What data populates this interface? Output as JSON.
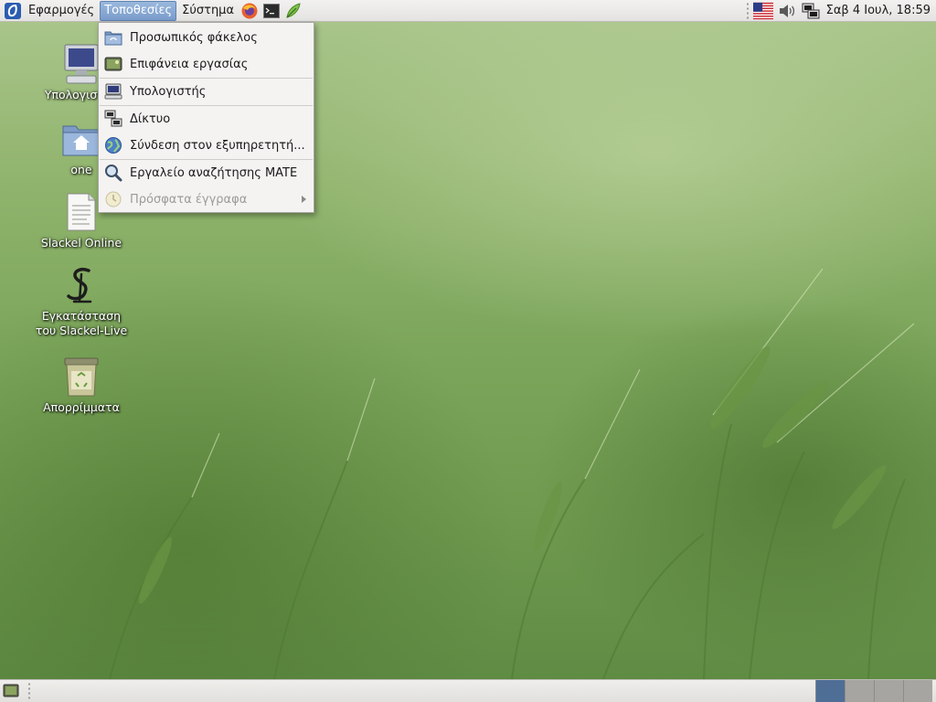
{
  "top_panel": {
    "menus": [
      {
        "label": "Εφαρμογές",
        "active": false
      },
      {
        "label": "Τοποθεσίες",
        "active": true
      },
      {
        "label": "Σύστημα",
        "active": false
      }
    ],
    "launchers": [
      "firefox-icon",
      "terminal-icon",
      "text-editor-icon"
    ],
    "tray": [
      "us-flag-keyboard-layout-icon",
      "volume-icon",
      "network-icon"
    ],
    "clock": "Σαβ  4 Ιουλ, 18:59"
  },
  "places_menu": {
    "items": [
      {
        "label": "Προσωπικός φάκελος",
        "icon": "home-folder-icon",
        "enabled": true
      },
      {
        "label": "Επιφάνεια εργασίας",
        "icon": "desktop-icon",
        "enabled": true
      },
      {
        "label": "Υπολογιστής",
        "icon": "computer-icon",
        "enabled": true
      },
      {
        "label": "Δίκτυο",
        "icon": "network-icon",
        "enabled": true
      },
      {
        "label": "Σύνδεση στον εξυπηρετητή...",
        "icon": "globe-icon",
        "enabled": true
      },
      {
        "label": "Εργαλείο αναζήτησης MATE",
        "icon": "search-icon",
        "enabled": true
      },
      {
        "label": "Πρόσφατα έγγραφα",
        "icon": "clock-icon",
        "enabled": false,
        "submenu": true
      }
    ]
  },
  "desktop": {
    "icons": [
      {
        "label": "Υπολογιστής",
        "icon": "computer-icon"
      },
      {
        "label": "one",
        "icon": "home-folder-icon"
      },
      {
        "label": "Slackel Online",
        "icon": "document-icon"
      },
      {
        "label": "Εγκατάσταση του Slackel-Live",
        "icon": "slackel-logo-icon"
      },
      {
        "label": "Απορρίμματα",
        "icon": "trash-icon"
      }
    ]
  },
  "bottom_panel": {
    "workspaces": [
      {
        "active": true
      },
      {
        "active": false
      },
      {
        "active": false
      },
      {
        "active": false
      }
    ]
  },
  "colors": {
    "menu_highlight": "#7a9ccb",
    "workspace_active": "#4e6e96",
    "panel_bg": "#ecebe9"
  }
}
